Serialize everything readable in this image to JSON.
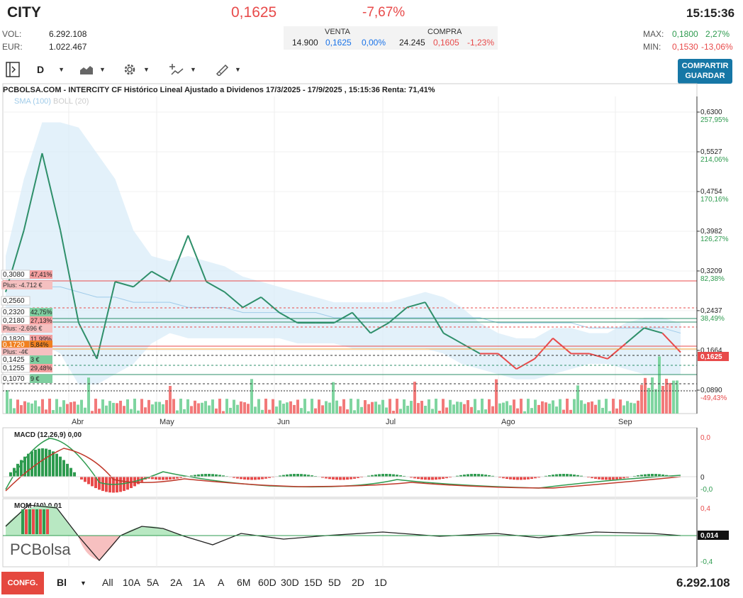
{
  "header": {
    "ticker": "CITY",
    "price": "0,1625",
    "change": "-7,67%",
    "time": "15:15:36",
    "vol_label": "VOL:",
    "vol_value": "6.292.108",
    "eur_label": "EUR:",
    "eur_value": "1.022.467",
    "venta_label": "VENTA",
    "venta_qty": "14.900",
    "venta_price": "0,1625",
    "venta_pct": "0,00%",
    "compra_label": "COMPRA",
    "compra_qty": "24.245",
    "compra_price": "0,1605",
    "compra_pct": "-1,23%",
    "max_label": "MAX:",
    "max_value": "0,1800",
    "max_pct": "2,27%",
    "min_label": "MIN:",
    "min_value": "0,1530",
    "min_pct": "-13,06%"
  },
  "toolbar": {
    "interval": "D",
    "share_line1": "COMPARTIR",
    "share_line2": "GUARDAR"
  },
  "chart": {
    "title": "PCBOLSA.COM - INTERCITY CF Histórico Lineal Ajustado a Dividenos 17/3/2025 - 17/9/2025 , 15:15:36 Renta: 71,41%",
    "legend_sma": "SMA (100)",
    "legend_boll": "BOLL (20)",
    "axis_prices": [
      "0,6300",
      "0,5527",
      "0,4754",
      "0,3982",
      "0,3209",
      "0,2437",
      "0,1664",
      "0,0890"
    ],
    "axis_pcts": [
      "257,95%",
      "214,06%",
      "170,16%",
      "126,27%",
      "82,38%",
      "38,49%",
      "-49,43%"
    ],
    "current_tag": "0,1625",
    "months": [
      "Abr",
      "May",
      "Jun",
      "Jul",
      "Ago",
      "Sep"
    ],
    "left_tags": [
      {
        "price": "0,3080",
        "pct": "47,41%"
      },
      {
        "plus": "Plus: -4.712 €"
      },
      {
        "price": "0,2560",
        "pct": ""
      },
      {
        "price": "0,2320",
        "pct": "42,75%"
      },
      {
        "price": "0,2180",
        "pct": "27,13%"
      },
      {
        "plus": "Plus: -2.696 €"
      },
      {
        "price": "0,1820",
        "pct": "11,99%"
      },
      {
        "price": "0,1720",
        "pct": "5,84%"
      },
      {
        "plus": "Plus: -4€"
      },
      {
        "price": "0,1425",
        "pct": "3 €"
      },
      {
        "price": "0,1255",
        "pct": "29,48%"
      },
      {
        "price": "0,1070",
        "pct": "9 €"
      }
    ],
    "macd_label": "MACD (12,26,9)",
    "macd_value": "0,00",
    "macd_axis": [
      "0,0",
      "0",
      "-0,0"
    ],
    "mom_label": "MOM (10)",
    "mom_value": "0,01",
    "mom_axis": [
      "0,4",
      "0,014",
      "-0,4"
    ],
    "watermark": "PCBolsa",
    "colors": {
      "up": "#2e9b4f",
      "down": "#e84a4a",
      "boll": "#d9ecf8"
    }
  },
  "chart_data": {
    "type": "line",
    "title": "PCBOLSA.COM - INTERCITY CF Histórico Lineal Ajustado a Dividenos 17/3/2025 - 17/9/2025",
    "x": [
      "17/3",
      "21/3",
      "26/3",
      "31/3",
      "3/4",
      "8/4",
      "14/4",
      "17/4",
      "23/4",
      "28/4",
      "1/5",
      "5/5",
      "9/5",
      "15/5",
      "20/5",
      "26/5",
      "30/5",
      "5/6",
      "11/6",
      "17/6",
      "23/6",
      "27/6",
      "1/7",
      "4/7",
      "10/7",
      "16/7",
      "22/7",
      "28/7",
      "1/8",
      "7/8",
      "12/8",
      "18/8",
      "22/8",
      "28/8",
      "3/9",
      "9/9",
      "12/9",
      "17/9"
    ],
    "values": [
      0.28,
      0.4,
      0.55,
      0.4,
      0.22,
      0.15,
      0.3,
      0.29,
      0.32,
      0.3,
      0.39,
      0.3,
      0.28,
      0.25,
      0.27,
      0.24,
      0.22,
      0.22,
      0.22,
      0.24,
      0.2,
      0.22,
      0.25,
      0.26,
      0.2,
      0.18,
      0.16,
      0.16,
      0.13,
      0.15,
      0.19,
      0.16,
      0.16,
      0.15,
      0.18,
      0.21,
      0.2,
      0.1625
    ],
    "ylim": [
      0.089,
      0.63
    ]
  },
  "footer": {
    "conf_label": "CONFG.",
    "chart_type": "Bl",
    "ranges": [
      "All",
      "10A",
      "5A",
      "2A",
      "1A",
      "A",
      "6M",
      "60D",
      "30D",
      "15D",
      "5D",
      "2D",
      "1D"
    ],
    "total_volume": "6.292.108"
  }
}
